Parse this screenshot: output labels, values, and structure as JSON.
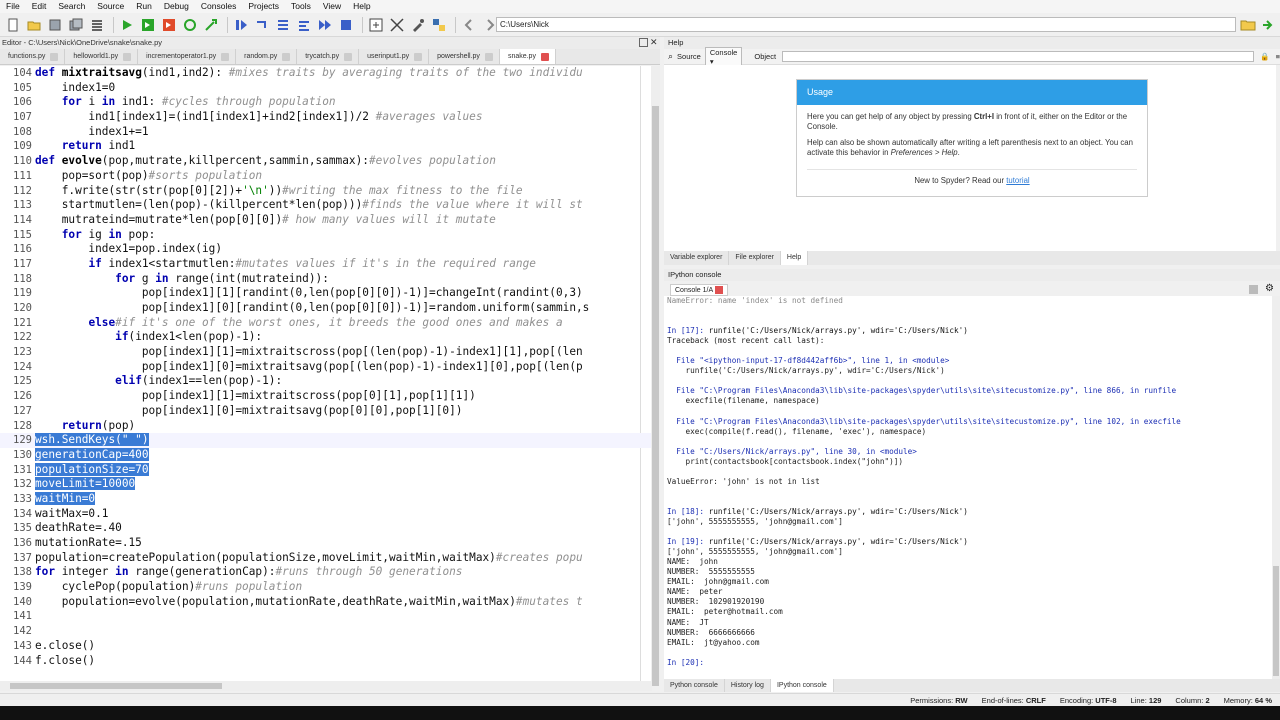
{
  "menu": [
    "File",
    "Edit",
    "Search",
    "Source",
    "Run",
    "Debug",
    "Consoles",
    "Projects",
    "Tools",
    "View",
    "Help"
  ],
  "toolbar": {
    "path": "C:\\Users\\Nick"
  },
  "editor": {
    "title": "Editor - C:\\Users\\Nick\\OneDrive\\snake\\snake.py",
    "tabs": [
      "functions.py",
      "helloworld1.py",
      "incrementoperator1.py",
      "random.py",
      "trycatch.py",
      "userinput1.py",
      "powershell.py",
      "snake.py"
    ],
    "lines": [
      {
        "n": "104",
        "segs": [
          [
            "kw",
            "def "
          ],
          [
            "fn",
            "mixtraitsavg"
          ],
          [
            "",
            "(ind1,ind2): "
          ],
          [
            "cm",
            "#mixes traits by averaging traits of the two individu"
          ]
        ]
      },
      {
        "n": "105",
        "segs": [
          [
            "",
            "    index1=0"
          ]
        ]
      },
      {
        "n": "106",
        "segs": [
          [
            "",
            "    "
          ],
          [
            "kw",
            "for "
          ],
          [
            "",
            "i "
          ],
          [
            "kw",
            "in "
          ],
          [
            "",
            "ind1: "
          ],
          [
            "cm",
            "#cycles through population"
          ]
        ]
      },
      {
        "n": "107",
        "segs": [
          [
            "",
            "        ind1[index1]=(ind1[index1]+ind2[index1])/2 "
          ],
          [
            "cm",
            "#averages values"
          ]
        ]
      },
      {
        "n": "108",
        "segs": [
          [
            "",
            "        index1+=1"
          ]
        ]
      },
      {
        "n": "109",
        "segs": [
          [
            "",
            "    "
          ],
          [
            "kw",
            "return "
          ],
          [
            "",
            "ind1"
          ]
        ]
      },
      {
        "n": "110",
        "segs": [
          [
            "kw",
            "def "
          ],
          [
            "fn",
            "evolve"
          ],
          [
            "",
            "(pop,mutrate,killpercent,sammin,sammax):"
          ],
          [
            "cm",
            "#evolves population"
          ]
        ]
      },
      {
        "n": "111",
        "segs": [
          [
            "",
            "    pop=sort(pop)"
          ],
          [
            "cm",
            "#sorts population"
          ]
        ]
      },
      {
        "n": "112",
        "segs": [
          [
            "",
            "    f.write(str(str(pop[0][2])+"
          ],
          [
            "st",
            "'\\n'"
          ],
          [
            "",
            "))"
          ],
          [
            "cm",
            "#writing the max fitness to the file"
          ]
        ]
      },
      {
        "n": "113",
        "segs": [
          [
            "",
            "    startmutlen=(len(pop)-(killpercent*len(pop)))"
          ],
          [
            "cm",
            "#finds the value where it will st"
          ]
        ]
      },
      {
        "n": "114",
        "segs": [
          [
            "",
            "    mutrateind=mutrate*len(pop[0][0])"
          ],
          [
            "cm",
            "# how many values will it mutate"
          ]
        ]
      },
      {
        "n": "115",
        "segs": [
          [
            "",
            "    "
          ],
          [
            "kw",
            "for "
          ],
          [
            "",
            "ig "
          ],
          [
            "kw",
            "in "
          ],
          [
            "",
            "pop:"
          ]
        ]
      },
      {
        "n": "116",
        "segs": [
          [
            "",
            "        index1=pop.index(ig)"
          ]
        ]
      },
      {
        "n": "117",
        "segs": [
          [
            "",
            "        "
          ],
          [
            "kw",
            "if "
          ],
          [
            "",
            "index1<startmutlen:"
          ],
          [
            "cm",
            "#mutates values if it's in the required range"
          ]
        ]
      },
      {
        "n": "118",
        "segs": [
          [
            "",
            "            "
          ],
          [
            "kw",
            "for "
          ],
          [
            "",
            "g "
          ],
          [
            "kw",
            "in "
          ],
          [
            "",
            "range(int(mutrateind)):"
          ]
        ]
      },
      {
        "n": "119",
        "segs": [
          [
            "",
            "                pop[index1][1][randint(0,len(pop[0][0])-1)]=changeInt(randint(0,3)"
          ]
        ]
      },
      {
        "n": "120",
        "segs": [
          [
            "",
            "                pop[index1][0][randint(0,len(pop[0][0])-1)]=random.uniform(sammin,s"
          ]
        ]
      },
      {
        "n": "121",
        "segs": [
          [
            "",
            "        "
          ],
          [
            "kw",
            "else"
          ],
          [
            ":  "
          ],
          [
            "cm",
            "#if it's one of the worst ones, it breeds the good ones and makes a"
          ]
        ]
      },
      {
        "n": "122",
        "segs": [
          [
            "",
            "            "
          ],
          [
            "kw",
            "if"
          ],
          [
            "",
            "(index1<len(pop)-1):"
          ]
        ]
      },
      {
        "n": "123",
        "segs": [
          [
            "",
            "                pop[index1][1]=mixtraitscross(pop[(len(pop)-1)-index1][1],pop[(len"
          ]
        ]
      },
      {
        "n": "124",
        "segs": [
          [
            "",
            "                pop[index1][0]=mixtraitsavg(pop[(len(pop)-1)-index1][0],pop[(len(p"
          ]
        ]
      },
      {
        "n": "125",
        "segs": [
          [
            "",
            "            "
          ],
          [
            "kw",
            "elif"
          ],
          [
            "",
            "(index1==len(pop)-1):"
          ]
        ]
      },
      {
        "n": "126",
        "segs": [
          [
            "",
            "                pop[index1][1]=mixtraitscross(pop[0][1],pop[1][1])"
          ]
        ]
      },
      {
        "n": "127",
        "segs": [
          [
            "",
            "                pop[index1][0]=mixtraitsavg(pop[0][0],pop[1][0])"
          ]
        ]
      },
      {
        "n": "128",
        "segs": [
          [
            "",
            "    "
          ],
          [
            "kw",
            "return"
          ],
          [
            "",
            "(pop)"
          ]
        ]
      },
      {
        "n": "129",
        "segs": [
          [
            "sel",
            "wsh.SendKeys(\" \")"
          ]
        ],
        "current": true
      },
      {
        "n": "130",
        "segs": [
          [
            "sel",
            "generationCap=400"
          ]
        ]
      },
      {
        "n": "131",
        "segs": [
          [
            "sel",
            "populationSize=70"
          ]
        ]
      },
      {
        "n": "132",
        "segs": [
          [
            "sel",
            "moveLimit=10000"
          ]
        ]
      },
      {
        "n": "133",
        "segs": [
          [
            "sel",
            "waitMin=0"
          ]
        ]
      },
      {
        "n": "134",
        "segs": [
          [
            "",
            "waitMax=0.1"
          ]
        ]
      },
      {
        "n": "135",
        "segs": [
          [
            "",
            "deathRate=.40"
          ]
        ]
      },
      {
        "n": "136",
        "segs": [
          [
            "",
            "mutationRate=.15"
          ]
        ]
      },
      {
        "n": "137",
        "segs": [
          [
            "",
            "population=createPopulation(populationSize,moveLimit,waitMin,waitMax)"
          ],
          [
            "cm",
            "#creates popu"
          ]
        ]
      },
      {
        "n": "138",
        "segs": [
          [
            "kw",
            "for "
          ],
          [
            "",
            "integer "
          ],
          [
            "kw",
            "in "
          ],
          [
            "",
            "range(generationCap):"
          ],
          [
            "cm",
            "#runs through 50 generations"
          ]
        ]
      },
      {
        "n": "139",
        "segs": [
          [
            "",
            "    cyclePop(population)"
          ],
          [
            "cm",
            "#runs population"
          ]
        ]
      },
      {
        "n": "140",
        "segs": [
          [
            "",
            "    population=evolve(population,mutationRate,deathRate,waitMin,waitMax)"
          ],
          [
            "cm",
            "#mutates t"
          ]
        ]
      },
      {
        "n": "141",
        "segs": [
          [
            "",
            ""
          ]
        ]
      },
      {
        "n": "142",
        "segs": [
          [
            "",
            ""
          ]
        ]
      },
      {
        "n": "143",
        "segs": [
          [
            "",
            "e.close()"
          ]
        ]
      },
      {
        "n": "144",
        "segs": [
          [
            "",
            "f.close()"
          ]
        ]
      }
    ]
  },
  "help": {
    "title": "Help",
    "source_label": "Source",
    "source_value": "Console",
    "object_label": "Object",
    "usage_title": "Usage",
    "usage_p1_a": "Here you can get help of any object by pressing ",
    "usage_p1_key": "Ctrl+I",
    "usage_p1_b": " in front of it, either on the Editor or the Console.",
    "usage_p2_a": "Help can also be shown automatically after writing a left parenthesis next to an object. You can activate this behavior in ",
    "usage_p2_em": "Preferences > Help",
    "usage_p2_b": ".",
    "usage_foot_a": "New to Spyder? Read our ",
    "usage_foot_link": "tutorial",
    "tabs": [
      "Variable explorer",
      "File explorer",
      "Help"
    ]
  },
  "console": {
    "title": "IPython console",
    "tab": "Console 1/A",
    "lines": [
      {
        "t": "mute",
        "s": "NameError: name 'index' is not defined"
      },
      {
        "t": "",
        "s": ""
      },
      {
        "t": "",
        "s": ""
      },
      {
        "t": "in",
        "p": "In [17]: ",
        "s": "runfile('C:/Users/Nick/arrays.py', wdir='C:/Users/Nick')"
      },
      {
        "t": "",
        "s": "Traceback (most recent call last):"
      },
      {
        "t": "",
        "s": ""
      },
      {
        "t": "err",
        "s": "  File \"<ipython-input-17-df8d442aff6b>\", line 1, in <module>"
      },
      {
        "t": "",
        "s": "    runfile('C:/Users/Nick/arrays.py', wdir='C:/Users/Nick')"
      },
      {
        "t": "",
        "s": ""
      },
      {
        "t": "err",
        "s": "  File \"C:\\Program Files\\Anaconda3\\lib\\site-packages\\spyder\\utils\\site\\sitecustomize.py\", line 866, in runfile"
      },
      {
        "t": "",
        "s": "    execfile(filename, namespace)"
      },
      {
        "t": "",
        "s": ""
      },
      {
        "t": "err",
        "s": "  File \"C:\\Program Files\\Anaconda3\\lib\\site-packages\\spyder\\utils\\site\\sitecustomize.py\", line 102, in execfile"
      },
      {
        "t": "",
        "s": "    exec(compile(f.read(), filename, 'exec'), namespace)"
      },
      {
        "t": "",
        "s": ""
      },
      {
        "t": "err",
        "s": "  File \"C:/Users/Nick/arrays.py\", line 30, in <module>"
      },
      {
        "t": "",
        "s": "    print(contactsbook[contactsbook.index(\"john\")])"
      },
      {
        "t": "",
        "s": ""
      },
      {
        "t": "",
        "s": "ValueError: 'john' is not in list"
      },
      {
        "t": "",
        "s": ""
      },
      {
        "t": "",
        "s": ""
      },
      {
        "t": "in",
        "p": "In [18]: ",
        "s": "runfile('C:/Users/Nick/arrays.py', wdir='C:/Users/Nick')"
      },
      {
        "t": "",
        "s": "['john', 5555555555, 'john@gmail.com']"
      },
      {
        "t": "",
        "s": ""
      },
      {
        "t": "in",
        "p": "In [19]: ",
        "s": "runfile('C:/Users/Nick/arrays.py', wdir='C:/Users/Nick')"
      },
      {
        "t": "",
        "s": "['john', 5555555555, 'john@gmail.com']"
      },
      {
        "t": "",
        "s": "NAME:  john"
      },
      {
        "t": "",
        "s": "NUMBER:  5555555555"
      },
      {
        "t": "",
        "s": "EMAIL:  john@gmail.com"
      },
      {
        "t": "",
        "s": "NAME:  peter"
      },
      {
        "t": "",
        "s": "NUMBER:  102901920190"
      },
      {
        "t": "",
        "s": "EMAIL:  peter@hotmail.com"
      },
      {
        "t": "",
        "s": "NAME:  JT"
      },
      {
        "t": "",
        "s": "NUMBER:  6666666666"
      },
      {
        "t": "",
        "s": "EMAIL:  jt@yahoo.com"
      },
      {
        "t": "",
        "s": ""
      },
      {
        "t": "in",
        "p": "In [20]: ",
        "s": ""
      }
    ],
    "bottom_tabs": [
      "Python console",
      "History log",
      "IPython console"
    ]
  },
  "status": {
    "permissions_label": "Permissions:",
    "permissions": "RW",
    "eol_label": "End-of-lines:",
    "eol": "CRLF",
    "encoding_label": "Encoding:",
    "encoding": "UTF-8",
    "line_label": "Line:",
    "line": "129",
    "column_label": "Column:",
    "column": "2",
    "memory_label": "Memory:",
    "memory": "64 %"
  },
  "colors": {
    "accent": "#2e9ee6",
    "selection": "#3a7bd5",
    "keyword": "#0000b0",
    "comment": "#909090"
  }
}
